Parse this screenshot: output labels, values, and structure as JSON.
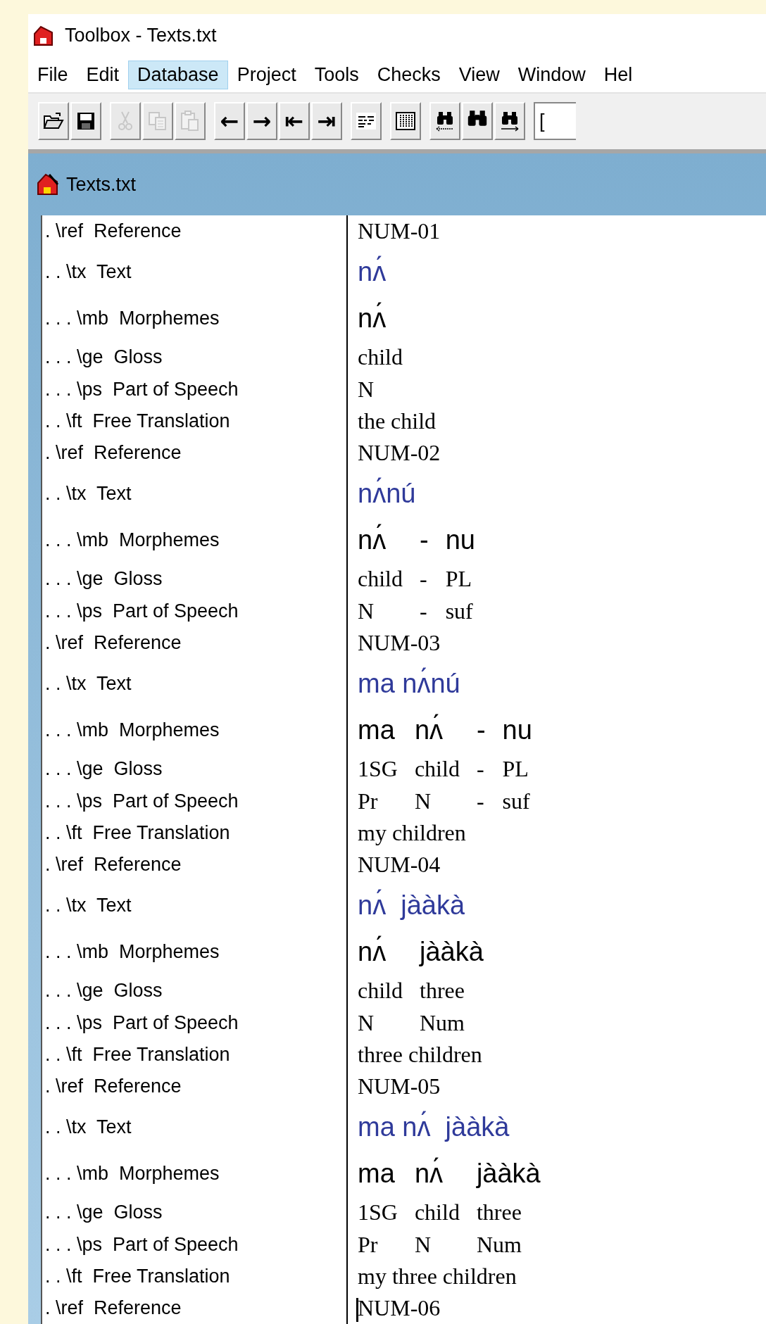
{
  "window": {
    "title": "Toolbox - Texts.txt"
  },
  "menu": [
    {
      "label": "File",
      "selected": false
    },
    {
      "label": "Edit",
      "selected": false
    },
    {
      "label": "Database",
      "selected": true
    },
    {
      "label": "Project",
      "selected": false
    },
    {
      "label": "Tools",
      "selected": false
    },
    {
      "label": "Checks",
      "selected": false
    },
    {
      "label": "View",
      "selected": false
    },
    {
      "label": "Window",
      "selected": false
    },
    {
      "label": "Hel",
      "selected": false
    }
  ],
  "toolbar": {
    "groups": [
      [
        {
          "kind": "open",
          "disabled": false
        },
        {
          "kind": "save",
          "disabled": false
        }
      ],
      [
        {
          "kind": "cut",
          "disabled": true
        },
        {
          "kind": "copy",
          "disabled": true
        },
        {
          "kind": "paste",
          "disabled": true
        }
      ],
      [
        {
          "kind": "glyph",
          "label": "←",
          "disabled": false
        },
        {
          "kind": "glyph",
          "label": "→",
          "disabled": false
        },
        {
          "kind": "glyph",
          "label": "⇤",
          "disabled": false
        },
        {
          "kind": "glyph",
          "label": "⇥",
          "disabled": false
        }
      ],
      [
        {
          "kind": "lines",
          "disabled": false
        }
      ],
      [
        {
          "kind": "columns",
          "disabled": false
        }
      ],
      [
        {
          "kind": "find-prev",
          "disabled": false
        },
        {
          "kind": "find",
          "disabled": false
        },
        {
          "kind": "find-next",
          "disabled": false
        }
      ]
    ],
    "field": {
      "value": "["
    }
  },
  "document": {
    "title": "Texts.txt",
    "records": [
      {
        "rows": [
          {
            "kind": "ref",
            "label": ". \\ref  Reference",
            "value": "NUM-01"
          },
          {
            "kind": "tx",
            "label": ". . \\tx  Text",
            "value": "nʌ́"
          },
          {
            "kind": "mb",
            "label": ". . . \\mb  Morphemes",
            "words": [
              "nʌ́"
            ]
          },
          {
            "kind": "ge",
            "label": ". . . \\ge  Gloss",
            "words": [
              "child"
            ]
          },
          {
            "kind": "ps",
            "label": ". . . \\ps  Part of Speech",
            "words": [
              "N"
            ]
          },
          {
            "kind": "ft",
            "label": ". . \\ft  Free Translation",
            "value": "the child"
          }
        ]
      },
      {
        "rows": [
          {
            "kind": "ref",
            "label": ". \\ref  Reference",
            "value": "NUM-02"
          },
          {
            "kind": "tx",
            "label": ". . \\tx  Text",
            "value": "nʌ́nú"
          },
          {
            "kind": "mb",
            "label": ". . . \\mb  Morphemes",
            "words": [
              "nʌ́",
              "-",
              "nu"
            ]
          },
          {
            "kind": "ge",
            "label": ". . . \\ge  Gloss",
            "words": [
              "child",
              "-",
              "PL"
            ]
          },
          {
            "kind": "ps",
            "label": ". . . \\ps  Part of Speech",
            "words": [
              "N",
              "-",
              "suf"
            ]
          }
        ]
      },
      {
        "rows": [
          {
            "kind": "ref",
            "label": ". \\ref  Reference",
            "value": "NUM-03"
          },
          {
            "kind": "tx",
            "label": ". . \\tx  Text",
            "value": "ma nʌ́nú"
          },
          {
            "kind": "mb",
            "label": ". . . \\mb  Morphemes",
            "words": [
              "ma",
              "nʌ́",
              "-",
              "nu"
            ]
          },
          {
            "kind": "ge",
            "label": ". . . \\ge  Gloss",
            "words": [
              "1SG",
              "child",
              "-",
              "PL"
            ]
          },
          {
            "kind": "ps",
            "label": ". . . \\ps  Part of Speech",
            "words": [
              "Pr",
              "N",
              "-",
              "suf"
            ]
          },
          {
            "kind": "ft",
            "label": ". . \\ft  Free Translation",
            "value": "my children"
          }
        ]
      },
      {
        "rows": [
          {
            "kind": "ref",
            "label": ". \\ref  Reference",
            "value": "NUM-04"
          },
          {
            "kind": "tx",
            "label": ". . \\tx  Text",
            "value": "nʌ́  jààkà"
          },
          {
            "kind": "mb",
            "label": ". . . \\mb  Morphemes",
            "words": [
              "nʌ́",
              "jààkà"
            ]
          },
          {
            "kind": "ge",
            "label": ". . . \\ge  Gloss",
            "words": [
              "child",
              "three"
            ]
          },
          {
            "kind": "ps",
            "label": ". . . \\ps  Part of Speech",
            "words": [
              "N",
              "Num"
            ]
          },
          {
            "kind": "ft",
            "label": ". . \\ft  Free Translation",
            "value": "three children"
          }
        ]
      },
      {
        "rows": [
          {
            "kind": "ref",
            "label": ". \\ref  Reference",
            "value": "NUM-05"
          },
          {
            "kind": "tx",
            "label": ". . \\tx  Text",
            "value": "ma nʌ́  jààkà"
          },
          {
            "kind": "mb",
            "label": ". . . \\mb  Morphemes",
            "words": [
              "ma",
              "nʌ́",
              "jààkà"
            ]
          },
          {
            "kind": "ge",
            "label": ". . . \\ge  Gloss",
            "words": [
              "1SG",
              "child",
              "three"
            ]
          },
          {
            "kind": "ps",
            "label": ". . . \\ps  Part of Speech",
            "words": [
              "Pr",
              "N",
              "Num"
            ]
          },
          {
            "kind": "ft",
            "label": ". . \\ft  Free Translation",
            "value": "my three children"
          }
        ]
      },
      {
        "rows": [
          {
            "kind": "ref",
            "label": ". \\ref  Reference",
            "value": "NUM-06",
            "cursor": true
          }
        ]
      }
    ]
  }
}
